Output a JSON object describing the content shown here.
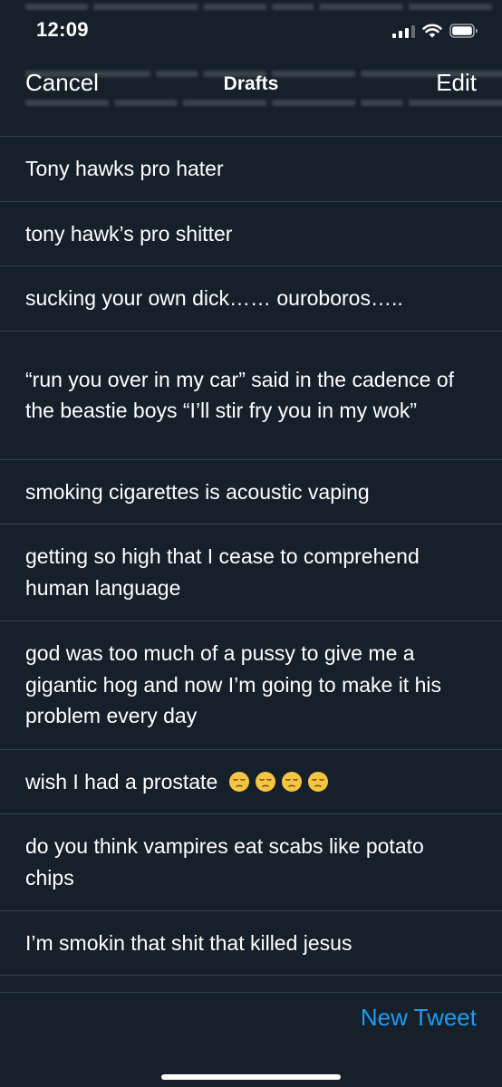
{
  "status_bar": {
    "time": "12:09"
  },
  "nav": {
    "cancel_label": "Cancel",
    "title": "Drafts",
    "edit_label": "Edit"
  },
  "drafts": [
    {
      "text": "Tony hawks pro hater"
    },
    {
      "text": "tony hawk’s pro shitter"
    },
    {
      "text": "sucking your own dick…… ouroboros….."
    },
    {
      "text": "“run you over in my car” said in the cadence of the beastie boys “I’ll stir fry you in my wok”"
    },
    {
      "text": "smoking cigarettes is acoustic vaping"
    },
    {
      "text": "getting so high that I cease to comprehend human language"
    },
    {
      "text": "god was too much of a pussy to give me a gigantic hog and now I’m going to make it his problem every day"
    },
    {
      "text": "wish I had a prostate",
      "emojis": [
        "pensive-face",
        "pensive-face",
        "pensive-face",
        "pensive-face"
      ]
    },
    {
      "text": "do you think vampires eat scabs like potato chips"
    },
    {
      "text": "I’m smokin that shit that killed jesus"
    }
  ],
  "toolbar": {
    "new_tweet_label": "New Tweet"
  },
  "colors": {
    "background": "#15202b",
    "separator": "#38444d",
    "accent": "#1d9bf0",
    "text": "#ffffff"
  }
}
